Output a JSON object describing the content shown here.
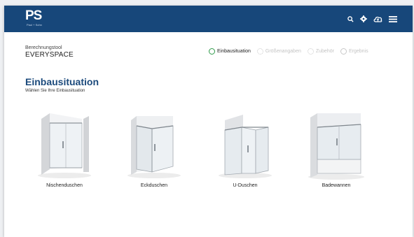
{
  "header": {
    "logo_text": "PS",
    "logo_subtitle": "Paul + Sohn",
    "brand_color": "#17477a",
    "icons": [
      "search-icon",
      "gear-icon",
      "cloud-upload-icon",
      "menu-icon"
    ]
  },
  "tool": {
    "label": "Berechnungstool",
    "name": "EVERYSPACE"
  },
  "steps": [
    {
      "label": "Einbausituation",
      "state": "active"
    },
    {
      "label": "Größenangaben",
      "state": "inactive"
    },
    {
      "label": "Zubehör",
      "state": "inactive"
    },
    {
      "label": "Ergebnis",
      "state": "inactive"
    }
  ],
  "section": {
    "title": "Einbausituation",
    "subtitle": "Wählen Sie Ihre Einbausituation"
  },
  "options": [
    {
      "label": "Nischenduschen"
    },
    {
      "label": "Eckduschen"
    },
    {
      "label": "U-Duschen"
    },
    {
      "label": "Badewannen"
    }
  ],
  "colors": {
    "accent": "#1b4a7c",
    "active_step": "#2f9a4a",
    "inactive_step": "#c4c4c4"
  }
}
